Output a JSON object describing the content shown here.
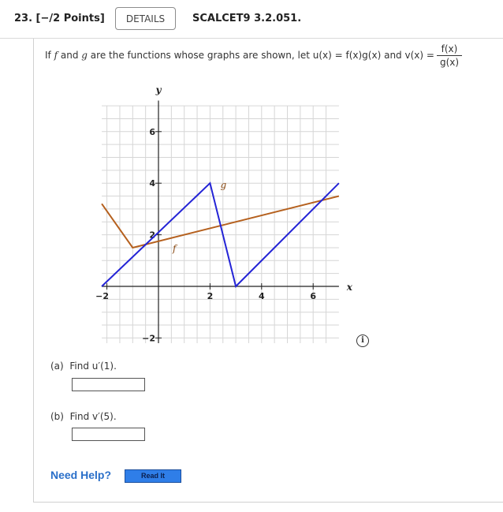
{
  "header": {
    "question_number": "23. [−/2 Points]",
    "details_label": "DETAILS",
    "problem_code": "SCALCET9 3.2.051."
  },
  "prompt": {
    "lead": "If",
    "f": "f",
    "and": "and",
    "g": "g",
    "middle": "are the functions whose graphs are shown, let",
    "u_def": "u(x) = f(x)g(x)",
    "and2": "and",
    "v_lhs": "v(x) =",
    "v_num": "f(x)",
    "v_den": "g(x)",
    "period": "."
  },
  "graph": {
    "x_axis_label": "x",
    "y_axis_label": "y",
    "x_ticks": [
      "−2",
      "2",
      "4",
      "6"
    ],
    "y_ticks": [
      "−2",
      "2",
      "4",
      "6"
    ],
    "f_label": "f",
    "g_label": "g",
    "f_color": "#b5601e",
    "g_color": "#2424d6",
    "xlim": [
      -2,
      7
    ],
    "ylim": [
      -2,
      7
    ],
    "f_points": [
      [
        -2.2,
        3.2
      ],
      [
        -1,
        1.5
      ],
      [
        7,
        3.5
      ]
    ],
    "g_points": [
      [
        -2.2,
        0
      ],
      [
        2,
        4
      ],
      [
        3,
        0
      ],
      [
        7,
        4
      ]
    ]
  },
  "info_icon": "info-icon",
  "part_a": {
    "label": "(a)",
    "text": "Find u′(1).",
    "value": ""
  },
  "part_b": {
    "label": "(b)",
    "text": "Find v′(5).",
    "value": ""
  },
  "help": {
    "label": "Need Help?",
    "read_it": "Read It"
  }
}
